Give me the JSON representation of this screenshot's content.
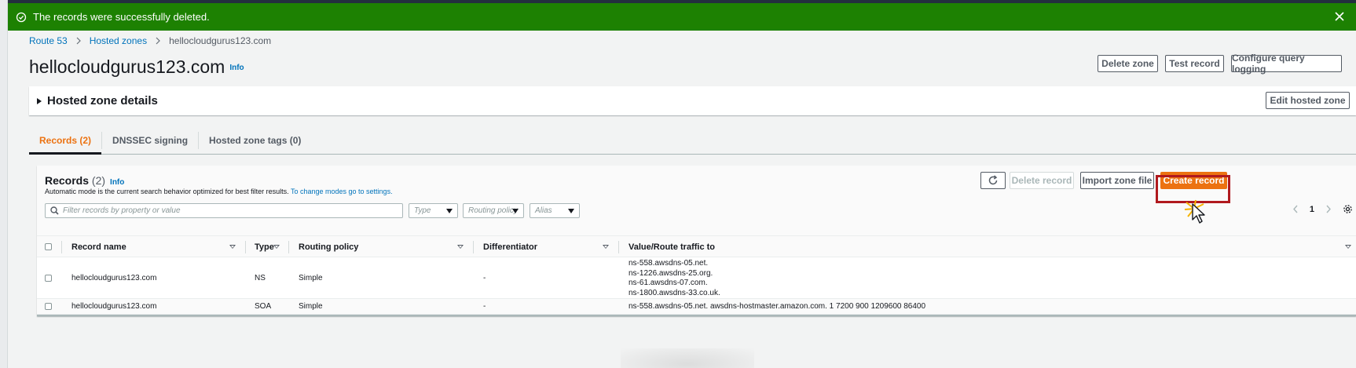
{
  "flash": {
    "message": "The records were successfully deleted.",
    "color": "#1d8102"
  },
  "breadcrumb": [
    "Route 53",
    "Hosted zones",
    "hellocloudgurus123.com"
  ],
  "header": {
    "title": "hellocloudgurus123.com",
    "info": "Info",
    "buttons": {
      "delete_zone": "Delete zone",
      "test_record": "Test record",
      "configure_query_logging": "Configure query logging"
    }
  },
  "hosted_zone_details": {
    "title": "Hosted zone details",
    "edit_button": "Edit hosted zone"
  },
  "tabs": [
    {
      "label": "Records (2)",
      "active": true
    },
    {
      "label": "DNSSEC signing",
      "active": false
    },
    {
      "label": "Hosted zone tags (0)",
      "active": false
    }
  ],
  "records": {
    "title": "Records",
    "count": "(2)",
    "info": "Info",
    "description": "Automatic mode is the current search behavior optimized for best filter results.",
    "description_link": "To change modes go to settings.",
    "search_placeholder": "Filter records by property or value",
    "filters": {
      "type": "Type",
      "routing_policy": "Routing policy",
      "alias": "Alias"
    },
    "buttons": {
      "delete_record": "Delete record",
      "import_zone_file": "Import zone file",
      "create_record": "Create record"
    },
    "page_number": "1",
    "accent_color": "#ec7211"
  },
  "table": {
    "columns": [
      "Record name",
      "Type",
      "Routing policy",
      "Differentiator",
      "Value/Route traffic to"
    ],
    "rows": [
      {
        "name": "hellocloudgurus123.com",
        "type": "NS",
        "routing": "Simple",
        "differentiator": "-",
        "values": [
          "ns-558.awsdns-05.net.",
          "ns-1226.awsdns-25.org.",
          "ns-61.awsdns-07.com.",
          "ns-1800.awsdns-33.co.uk."
        ]
      },
      {
        "name": "hellocloudgurus123.com",
        "type": "SOA",
        "routing": "Simple",
        "differentiator": "-",
        "values": [
          "ns-558.awsdns-05.net. awsdns-hostmaster.amazon.com. 1 7200 900 1209600 86400"
        ]
      }
    ]
  }
}
